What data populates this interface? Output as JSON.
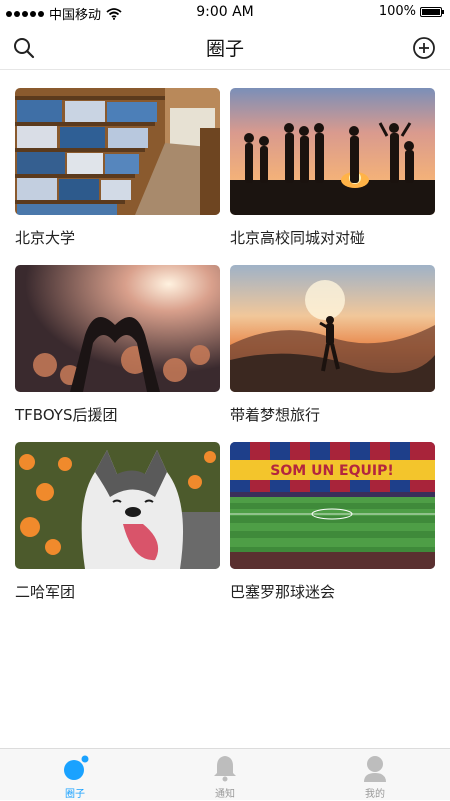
{
  "status_bar": {
    "carrier": "中国移动",
    "time": "9:00 AM",
    "battery": "100%"
  },
  "nav": {
    "title": "圈子"
  },
  "circles": [
    {
      "name": "北京大学",
      "image": "library-bookshelves"
    },
    {
      "name": "北京高校同城对对碰",
      "image": "bonfire-sunset-silhouettes"
    },
    {
      "name": "TFBOYS后援团",
      "image": "concert-heart-hands"
    },
    {
      "name": "带着梦想旅行",
      "image": "hiker-mountain-sunset"
    },
    {
      "name": "二哈军团",
      "image": "husky-dog-flowers"
    },
    {
      "name": "巴塞罗那球迷会",
      "image": "stadium-som-un-equip"
    }
  ],
  "stadium_banner": "SOM UN EQUIP!",
  "tabs": [
    {
      "label": "圈子",
      "icon": "circle-dot-icon",
      "active": true
    },
    {
      "label": "通知",
      "icon": "bell-icon",
      "active": false
    },
    {
      "label": "我的",
      "icon": "user-icon",
      "active": false
    }
  ],
  "colors": {
    "accent": "#1aa2ff",
    "tab_inactive": "#bdbdbd"
  }
}
